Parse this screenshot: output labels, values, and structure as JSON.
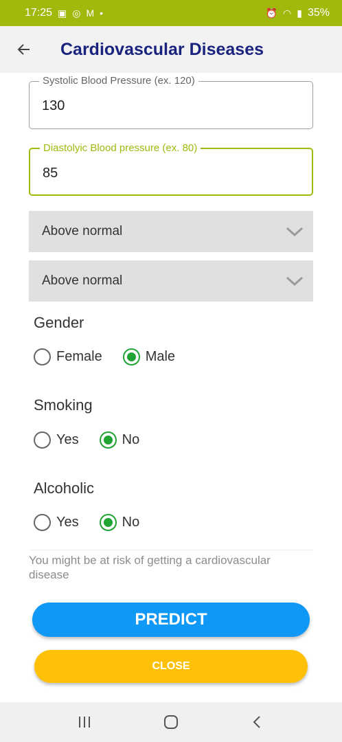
{
  "status_bar": {
    "time": "17:25",
    "battery": "35%"
  },
  "header": {
    "title": "Cardiovascular Diseases",
    "back_icon": "arrow-left-icon"
  },
  "form": {
    "systolic": {
      "label": "Systolic Blood Pressure (ex. 120)",
      "value": "130"
    },
    "diastolic": {
      "label": "Diastolyic Blood pressure (ex. 80)",
      "value": "85"
    },
    "select1": {
      "value": "Above normal"
    },
    "select2": {
      "value": "Above normal"
    },
    "gender": {
      "label": "Gender",
      "options": [
        "Female",
        "Male"
      ],
      "selected": "Male"
    },
    "smoking": {
      "label": "Smoking",
      "options": [
        "Yes",
        "No"
      ],
      "selected": "No"
    },
    "alcoholic": {
      "label": "Alcoholic",
      "options": [
        "Yes",
        "No"
      ],
      "selected": "No"
    }
  },
  "result_text": "You might be at risk of getting a cardiovascular disease",
  "buttons": {
    "predict": "PREDICT",
    "close": "CLOSE"
  },
  "colors": {
    "accent": "#a3b80d",
    "title": "#1a237e",
    "predict": "#0f98f5",
    "close": "#ffc107",
    "radio": "#1fa332"
  }
}
